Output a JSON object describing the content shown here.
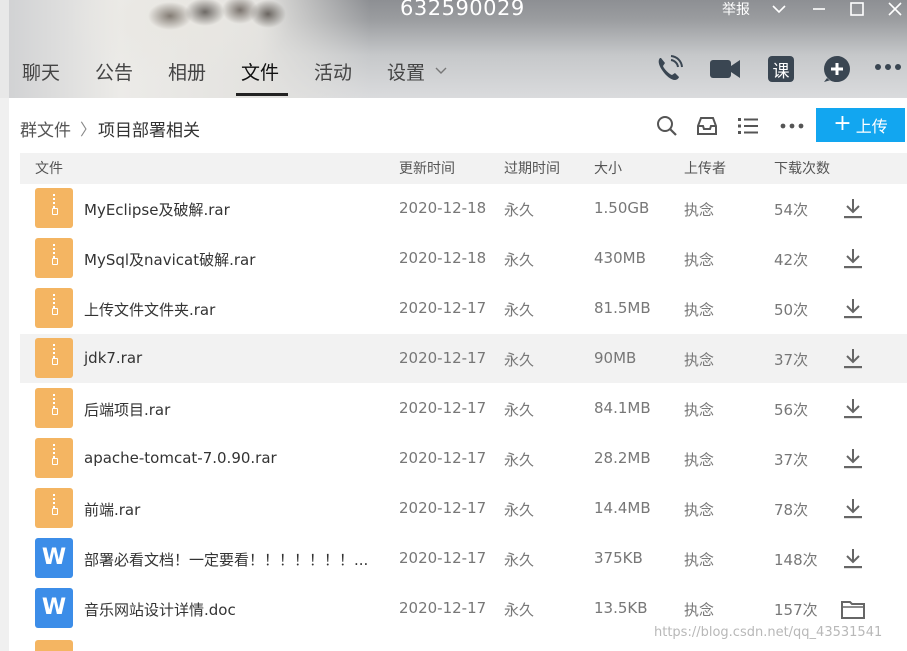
{
  "window": {
    "group_id": "632590029",
    "report_label": "举报"
  },
  "tabs": [
    {
      "label": "聊天"
    },
    {
      "label": "公告"
    },
    {
      "label": "相册"
    },
    {
      "label": "文件",
      "active": true
    },
    {
      "label": "活动"
    },
    {
      "label": "设置"
    }
  ],
  "header_icons": [
    "phone-call-icon",
    "video-call-icon",
    "course-icon",
    "add-chat-icon",
    "more-icon"
  ],
  "course_label": "课",
  "breadcrumb": {
    "root": "群文件",
    "separator": "〉",
    "current": "项目部署相关"
  },
  "toolbar": {
    "upload_label": "上传",
    "accent_color": "#12a6f0"
  },
  "table": {
    "columns": [
      "文件",
      "更新时间",
      "过期时间",
      "大小",
      "上传者",
      "下载次数"
    ],
    "rows": [
      {
        "type": "rar",
        "name": "MyEclipse及破解.rar",
        "date": "2020-12-18",
        "expire": "永久",
        "size": "1.50GB",
        "uploader": "执念",
        "downloads": "54次",
        "action": "download-icon"
      },
      {
        "type": "rar",
        "name": "MySql及navicat破解.rar",
        "date": "2020-12-18",
        "expire": "永久",
        "size": "430MB",
        "uploader": "执念",
        "downloads": "42次",
        "action": "download-icon"
      },
      {
        "type": "rar",
        "name": "上传文件文件夹.rar",
        "date": "2020-12-17",
        "expire": "永久",
        "size": "81.5MB",
        "uploader": "执念",
        "downloads": "50次",
        "action": "download-icon"
      },
      {
        "type": "rar",
        "name": "jdk7.rar",
        "date": "2020-12-17",
        "expire": "永久",
        "size": "90MB",
        "uploader": "执念",
        "downloads": "37次",
        "action": "download-icon"
      },
      {
        "type": "rar",
        "name": "后端项目.rar",
        "date": "2020-12-17",
        "expire": "永久",
        "size": "84.1MB",
        "uploader": "执念",
        "downloads": "56次",
        "action": "download-icon"
      },
      {
        "type": "rar",
        "name": "apache-tomcat-7.0.90.rar",
        "date": "2020-12-17",
        "expire": "永久",
        "size": "28.2MB",
        "uploader": "执念",
        "downloads": "37次",
        "action": "download-icon"
      },
      {
        "type": "rar",
        "name": "前端.rar",
        "date": "2020-12-17",
        "expire": "永久",
        "size": "14.4MB",
        "uploader": "执念",
        "downloads": "78次",
        "action": "download-icon"
      },
      {
        "type": "doc",
        "name": "部署必看文档！一定要看！！！！！！！...",
        "date": "2020-12-17",
        "expire": "永久",
        "size": "375KB",
        "uploader": "执念",
        "downloads": "148次",
        "action": "download-icon"
      },
      {
        "type": "doc",
        "name": "音乐网站设计详情.doc",
        "date": "2020-12-17",
        "expire": "永久",
        "size": "13.5KB",
        "uploader": "执念",
        "downloads": "157次",
        "action": "folder-icon"
      }
    ]
  },
  "doc_icon_letter": "W",
  "watermark": "https://blog.csdn.net/qq_43531541"
}
